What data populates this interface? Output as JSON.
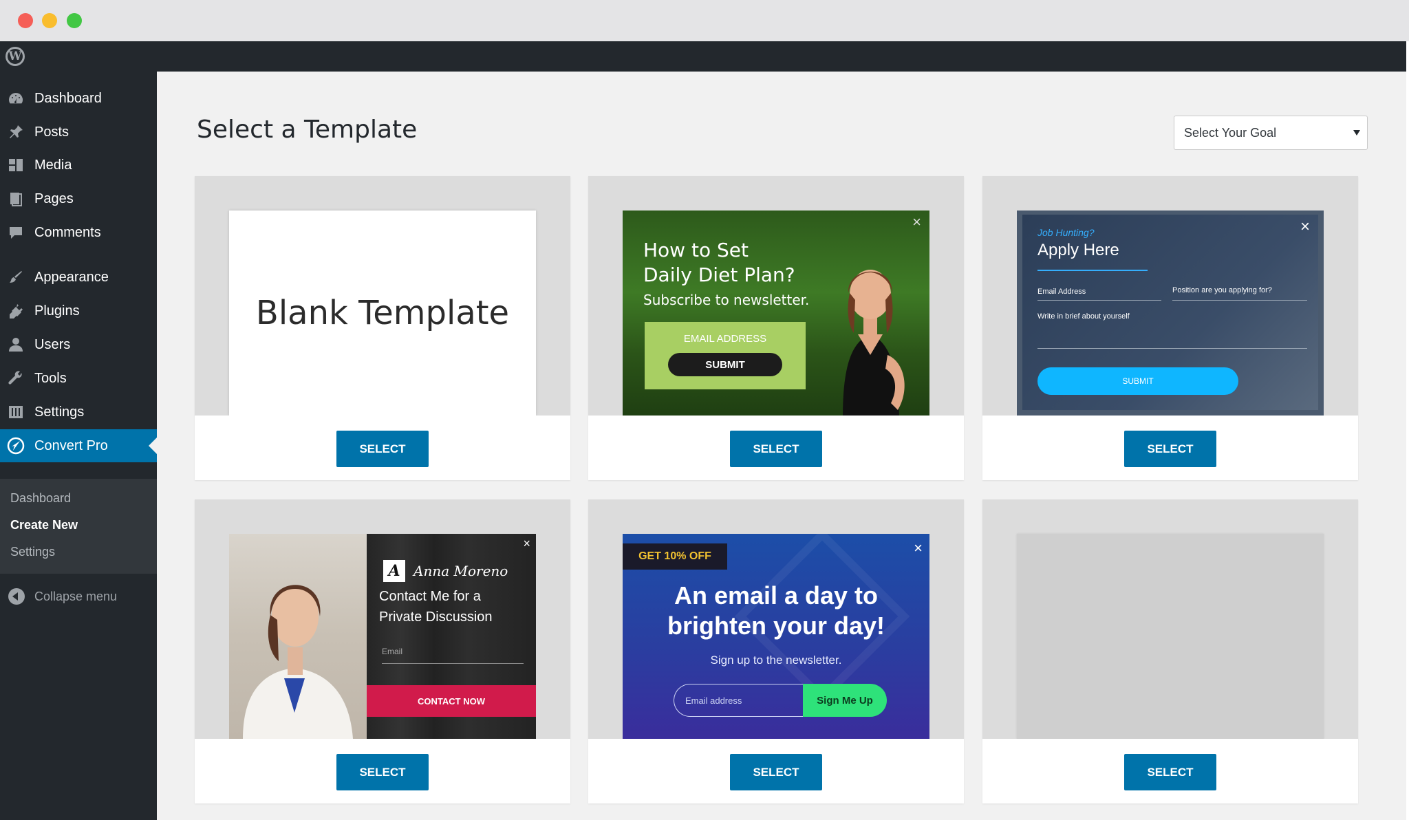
{
  "window": {
    "controls": [
      "close",
      "minimize",
      "maximize"
    ]
  },
  "adminbar": {
    "logo_icon": "wordpress-logo-icon",
    "logo_glyph": "W"
  },
  "sidebar": {
    "items": [
      {
        "label": "Dashboard",
        "icon": "dashboard-icon"
      },
      {
        "label": "Posts",
        "icon": "pin-icon"
      },
      {
        "label": "Media",
        "icon": "media-icon"
      },
      {
        "label": "Pages",
        "icon": "pages-icon"
      },
      {
        "label": "Comments",
        "icon": "comments-icon"
      },
      {
        "label": "Appearance",
        "icon": "brush-icon"
      },
      {
        "label": "Plugins",
        "icon": "plug-icon"
      },
      {
        "label": "Users",
        "icon": "user-icon"
      },
      {
        "label": "Tools",
        "icon": "wrench-icon"
      },
      {
        "label": "Settings",
        "icon": "settings-icon"
      },
      {
        "label": "Convert Pro",
        "icon": "convert-pro-icon",
        "active": true
      }
    ],
    "submenu": [
      {
        "label": "Dashboard"
      },
      {
        "label": "Create New",
        "current": true
      },
      {
        "label": "Settings"
      }
    ],
    "collapse_label": "Collapse menu"
  },
  "main": {
    "title": "Select a Template",
    "goal_select": {
      "value": "Select Your Goal"
    }
  },
  "templates": [
    {
      "name": "Blank Template",
      "select_label": "SELECT"
    },
    {
      "select_label": "SELECT",
      "heading_line1": "How to Set",
      "heading_line2": "Daily Diet Plan?",
      "subtitle": "Subscribe to newsletter.",
      "email_label": "EMAIL ADDRESS",
      "submit_label": "SUBMIT"
    },
    {
      "select_label": "SELECT",
      "kicker": "Job Hunting?",
      "heading": "Apply Here",
      "email_label": "Email Address",
      "position_label": "Position are you applying for?",
      "about_label": "Write in brief about yourself",
      "submit_label": "SUBMIT"
    },
    {
      "select_label": "SELECT",
      "logo_letter": "A",
      "signature": "Anna Moreno",
      "heading_line1": "Contact Me for a",
      "heading_line2": "Private Discussion",
      "email_label": "Email",
      "button_label": "CONTACT NOW"
    },
    {
      "select_label": "SELECT",
      "badge": "GET 10% OFF",
      "heading_line1": "An email a day to",
      "heading_line2": "brighten your day!",
      "subtitle": "Sign up to the newsletter.",
      "email_placeholder": "Email address",
      "button_label": "Sign Me Up"
    },
    {
      "select_label": "SELECT"
    }
  ],
  "colors": {
    "accent": "#0073aa",
    "sidebar_bg": "#23282d",
    "content_bg": "#f1f1f1"
  }
}
